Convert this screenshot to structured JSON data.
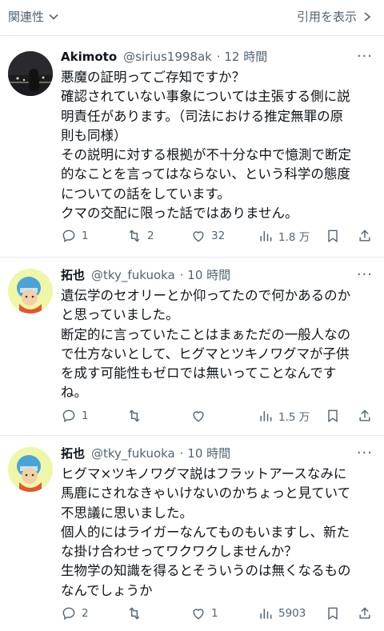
{
  "topbar": {
    "related": "関連性",
    "show_quotes": "引用を表示"
  },
  "tweets": [
    {
      "name": "Akimoto",
      "handle": "@sirius1998ak",
      "time": "· 12 時間",
      "lines": [
        "悪魔の証明ってご存知ですか？",
        "確認されていない事象については主張する側に説",
        "明責任があります。（司法における推定無罪の原",
        "則も同様）",
        "その説明に対する根拠が不十分な中で憶測で断定",
        "的なことを言ってはならない、という科学の態度",
        "についての話をしています。",
        "クマの交配に限った話ではありません。"
      ],
      "replies": "1",
      "reposts": "2",
      "likes": "32",
      "views": "1.8 万"
    },
    {
      "name": "拓也",
      "handle": "@tky_fukuoka",
      "time": "· 10 時間",
      "lines": [
        "遺伝学のセオリーとか仰ってたので何かあるのか",
        "と思っていました。",
        "断定的に言っていたことはまぁただの一般人なの",
        "で仕方ないとして、ヒグマとツキノワグマが子供",
        "を成す可能性もゼロでは無いってことなんです",
        "ね。"
      ],
      "replies": "1",
      "reposts": "",
      "likes": "",
      "views": "1.5 万"
    },
    {
      "name": "拓也",
      "handle": "@tky_fukuoka",
      "time": "· 10 時間",
      "lines": [
        "ヒグマ×ツキノワグマ説はフラットアースなみに",
        "馬鹿にされなきゃいけないのかちょっと見ていて",
        "不思議に思いました。",
        "個人的にはライガーなんてものもいますし、新た",
        "な掛け合わせってワクワクしませんか？",
        "生物学の知識を得るとそういうのは無くなるもの",
        "なんでしょうか"
      ],
      "replies": "2",
      "reposts": "",
      "likes": "1",
      "views": "5903"
    }
  ],
  "colors": {
    "text": "#0f1419",
    "secondary": "#536471",
    "divider": "#e6e9ec"
  },
  "icons": [
    "chevron-down-icon",
    "chevron-right-icon",
    "more-icon",
    "reply-icon",
    "repost-icon",
    "like-icon",
    "views-icon",
    "bookmark-icon",
    "share-icon"
  ]
}
